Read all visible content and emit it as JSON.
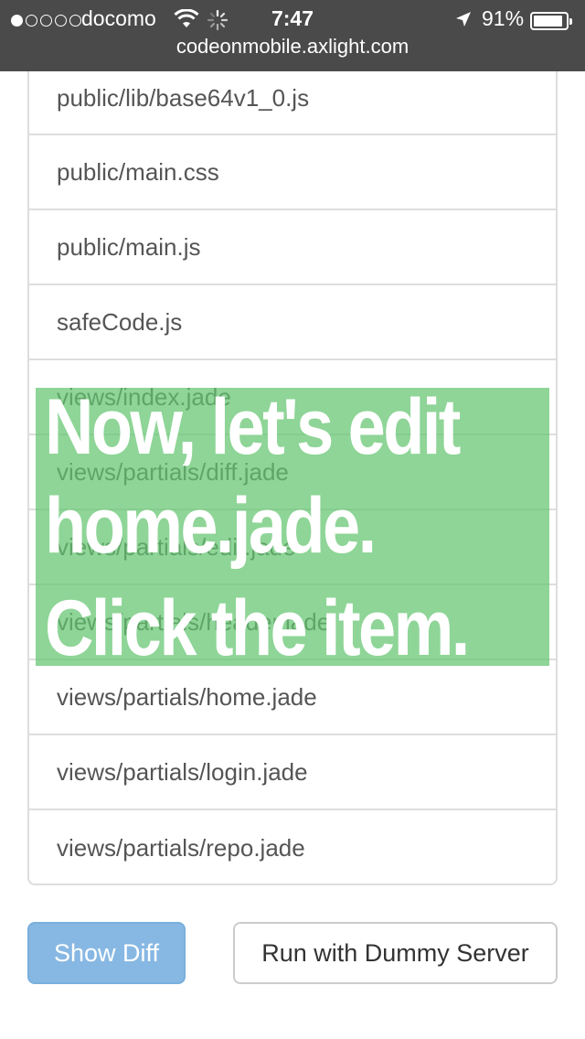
{
  "status_bar": {
    "carrier": "docomo",
    "signal_bars": 1,
    "time": "7:47",
    "battery_percent": "91%",
    "battery_level": 0.91,
    "icons": [
      "wifi-icon",
      "loading-spinner-icon",
      "location-arrow-icon",
      "battery-icon"
    ]
  },
  "browser": {
    "url": "codeonmobile.axlight.com"
  },
  "files": {
    "items": [
      "public/lib/base64v1_0.js",
      "public/main.css",
      "public/main.js",
      "safeCode.js",
      "views/index.jade",
      "views/partials/diff.jade",
      "views/partials/edit.jade",
      "views/partials/header.jade",
      "views/partials/home.jade",
      "views/partials/login.jade",
      "views/partials/repo.jade"
    ]
  },
  "buttons": {
    "show_diff": "Show Diff",
    "run_dummy": "Run with Dummy Server"
  },
  "overlay": {
    "line1": "Now, let's edit",
    "line2": "home.jade.",
    "line3": "Click the item."
  },
  "colors": {
    "status_bar_bg": "#4a4a4a",
    "overlay_green": "#63c56f",
    "primary_button": "#87b8e3",
    "list_text": "#555555",
    "list_border": "#dddddd"
  }
}
